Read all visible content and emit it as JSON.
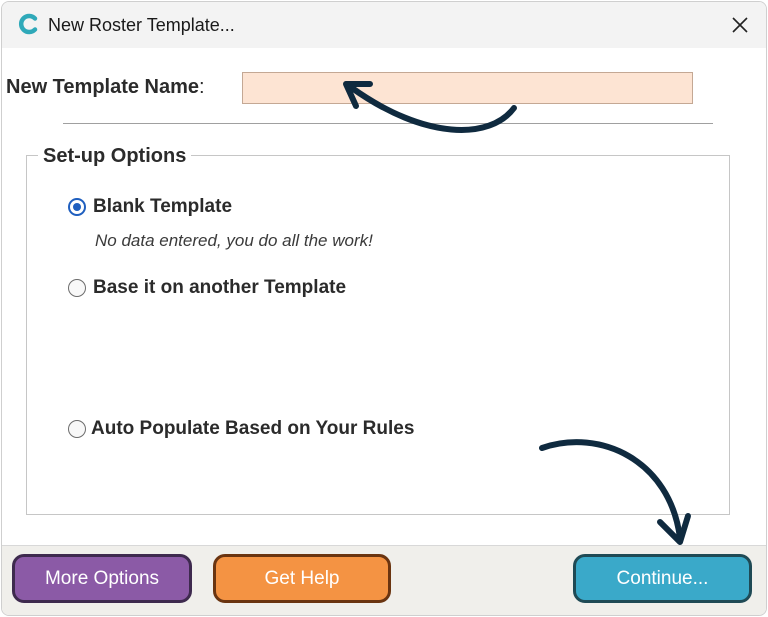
{
  "window": {
    "title": "New Roster Template...",
    "app_icon": "c-logo-icon",
    "close_icon": "close-icon"
  },
  "form": {
    "name_label": "New Template Name",
    "name_colon": ":",
    "name_value": "",
    "name_placeholder": ""
  },
  "setup": {
    "legend": "Set-up Options",
    "options": [
      {
        "label": "Blank Template",
        "checked": true,
        "hint": "No data entered, you do all the work!"
      },
      {
        "label": "Base it on another Template",
        "checked": false
      },
      {
        "label": "Auto Populate Based on Your Rules",
        "checked": false
      }
    ]
  },
  "footer": {
    "more_options": "More Options",
    "get_help": "Get Help",
    "continue": "Continue..."
  },
  "colors": {
    "input_bg": "#fde4d3",
    "radio_selected": "#1f5fbf",
    "more_btn": "#8b5aa6",
    "help_btn": "#f49343",
    "continue_btn": "#3aa9c9",
    "arrow": "#0f2a3f"
  },
  "annotations": [
    "curved-arrow-icon",
    "curved-arrow-icon"
  ]
}
